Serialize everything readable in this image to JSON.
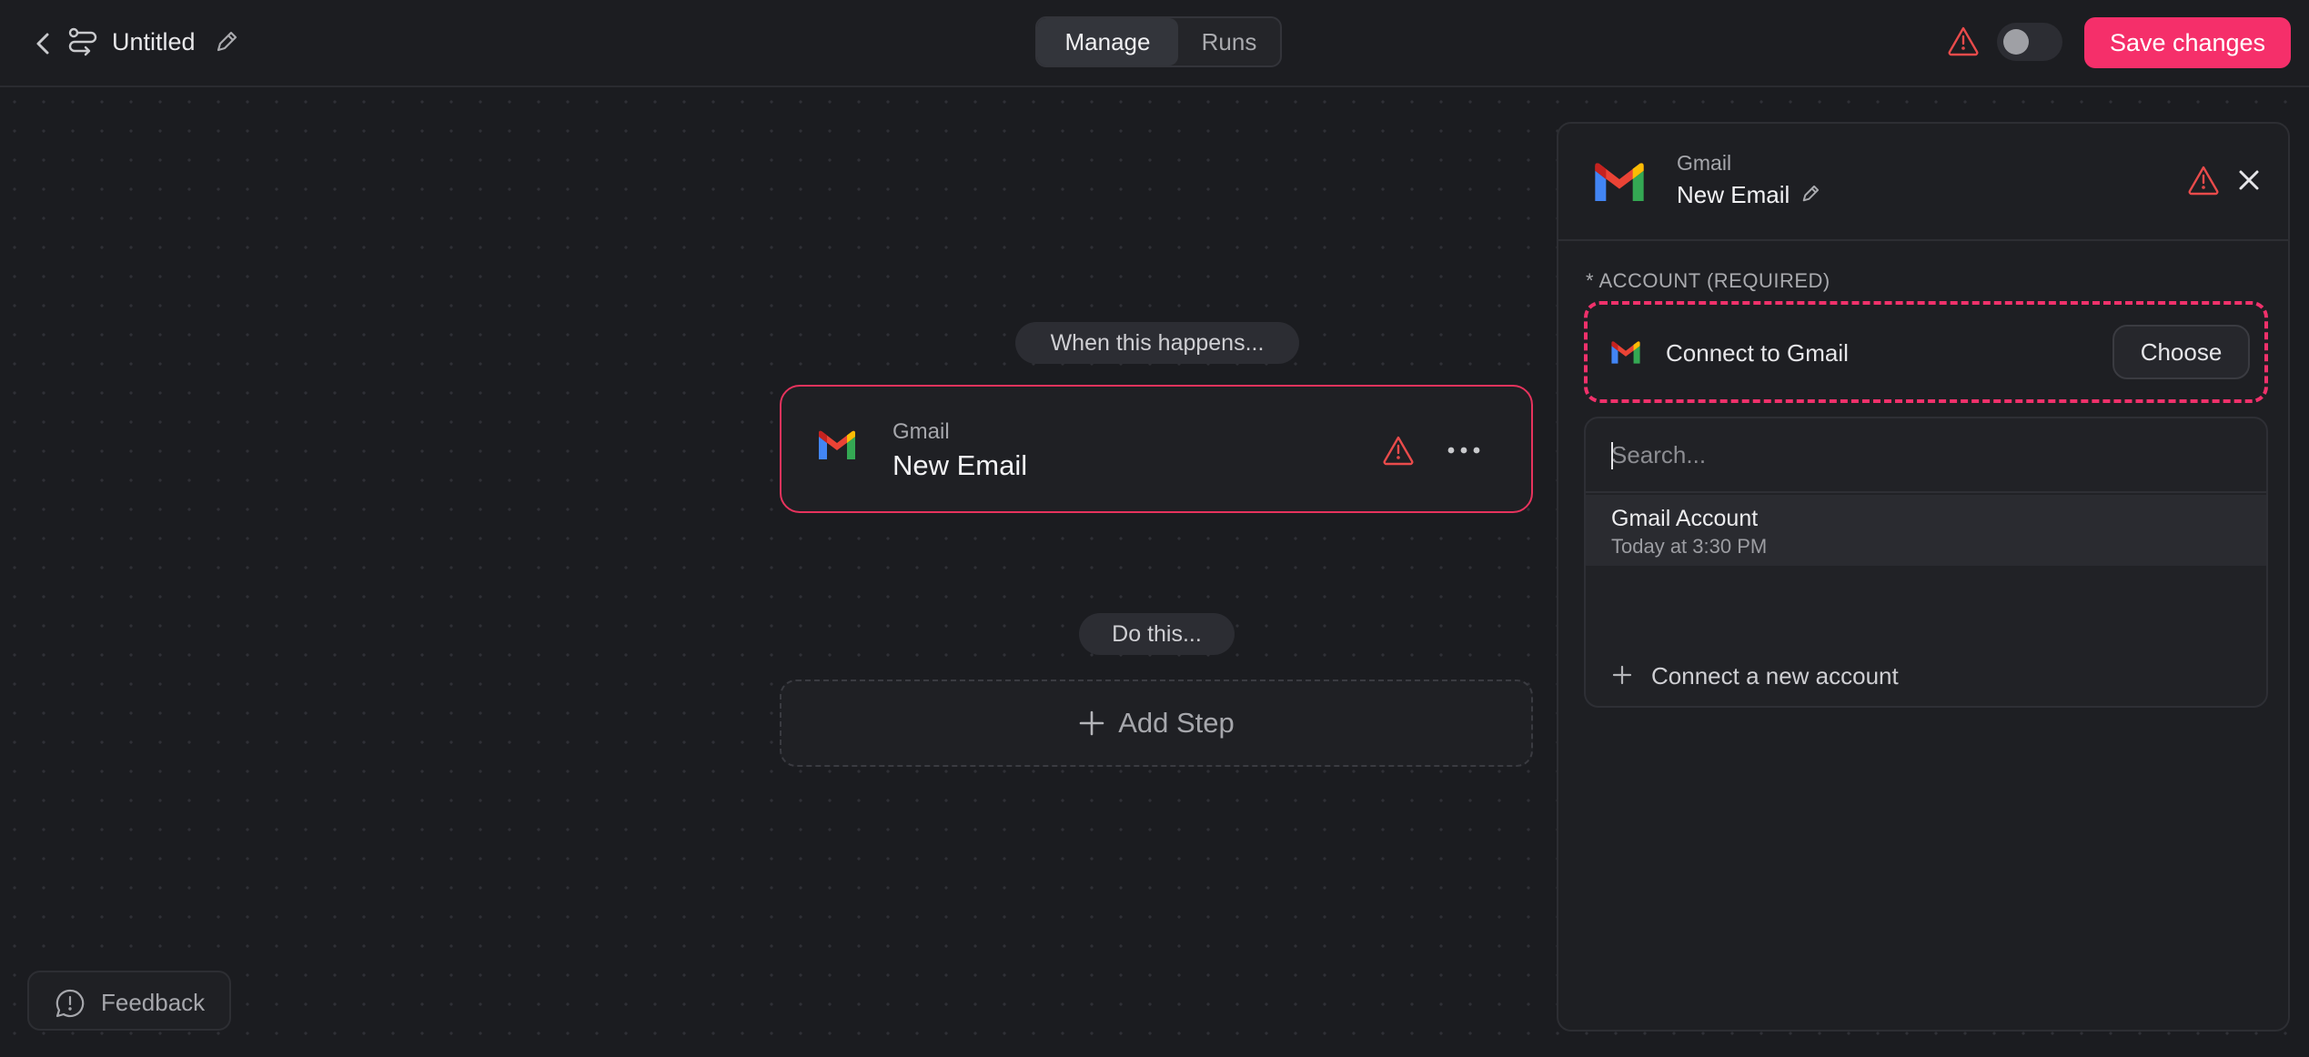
{
  "header": {
    "title": "Untitled",
    "tabs": [
      {
        "label": "Manage",
        "active": true
      },
      {
        "label": "Runs",
        "active": false
      }
    ],
    "save_label": "Save changes",
    "accent_color": "#f52f6a"
  },
  "canvas": {
    "trigger_pill": "When this happens...",
    "action_pill": "Do this...",
    "trigger_card": {
      "app": "Gmail",
      "event": "New Email"
    },
    "add_step_label": "Add Step",
    "feedback_label": "Feedback"
  },
  "panel": {
    "app": "Gmail",
    "event": "New Email",
    "account_label": "* ACCOUNT (REQUIRED)",
    "connect_text": "Connect to Gmail",
    "choose_label": "Choose",
    "search_placeholder": "Search...",
    "accounts": [
      {
        "name": "Gmail Account",
        "time": "Today at 3:30 PM"
      }
    ],
    "connect_new_label": "Connect a new account"
  },
  "colors": {
    "warning": "#e94b4b",
    "card_border": "#e7335d"
  },
  "icons": [
    "back-arrow-icon",
    "workflow-icon",
    "pencil-icon",
    "warning-icon",
    "toggle-switch",
    "gmail-icon",
    "more-icon",
    "plus-icon",
    "chat-icon",
    "close-icon"
  ]
}
